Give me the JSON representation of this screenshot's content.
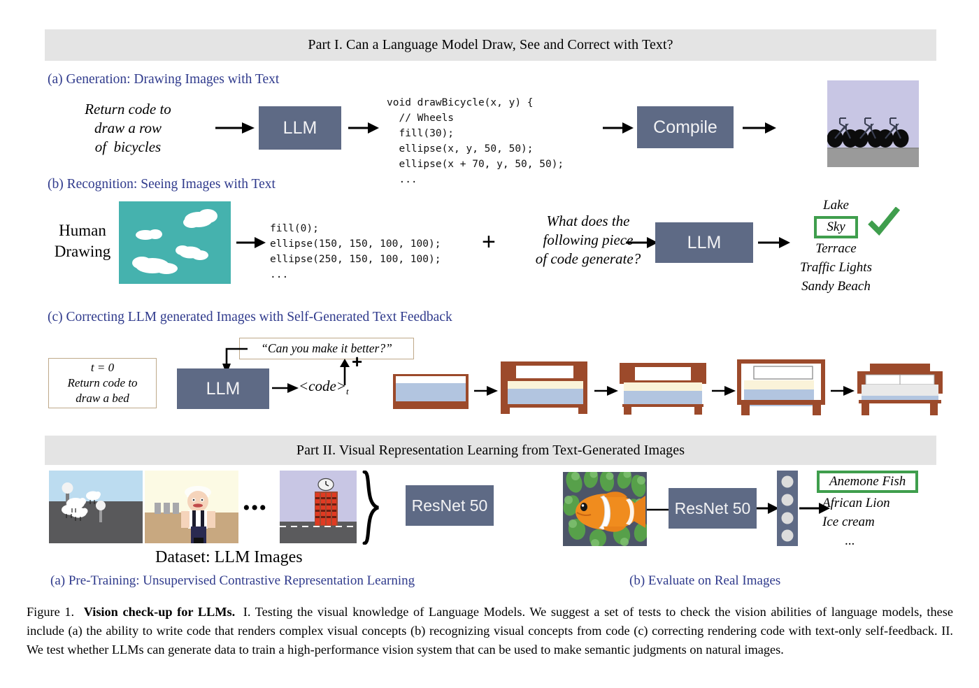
{
  "part1": {
    "banner": "Part I. Can a Language Model Draw, See and Correct with Text?",
    "section_a": {
      "heading": "(a) Generation: Drawing Images with Text",
      "prompt": "Return code to\ndraw a row\nof  bicycles",
      "llm_label": "LLM",
      "code": "void drawBicycle(x, y) {\n  // Wheels\n  fill(30);\n  ellipse(x, y, 50, 50);\n  ellipse(x + 70, y, 50, 50);\n  ...",
      "compile_label": "Compile",
      "output_image_name": "row-of-bicycles-render"
    },
    "section_b": {
      "heading": "(b) Recognition: Seeing Images with Text",
      "source_label": "Human\nDrawing",
      "drawing_name": "human-drawing-clouds",
      "code": "fill(0);\nellipse(150, 150, 100, 100);\nellipse(250, 150, 100, 100);\n...",
      "plus": "+",
      "question": "What does the\nfollowing piece\nof code generate?",
      "llm_label": "LLM",
      "answers": [
        "Lake",
        "Sky",
        "Terrace",
        "Traffic Lights",
        "Sandy Beach"
      ],
      "correct_answer": "Sky",
      "check_icon": "check-mark"
    },
    "section_c": {
      "heading": "(c) Correcting LLM generated Images with Self-Generated Text Feedback",
      "initial_prompt_line1": "t = 0",
      "initial_prompt_line2": "Return code to",
      "initial_prompt_line3": "draw a bed",
      "llm_label": "LLM",
      "code_token": "<code>",
      "code_token_sub": "t",
      "feedback": "“Can you make it better?”",
      "plus": "+",
      "bed_steps": [
        "bed-step-1",
        "bed-step-2",
        "bed-step-3",
        "bed-step-4",
        "bed-step-5"
      ]
    }
  },
  "part2": {
    "banner": "Part II. Visual Representation Learning from Text-Generated Images",
    "dataset_caption": "Dataset: LLM Images",
    "dataset_images": [
      "llm-image-sheep-field",
      "llm-image-chef-kitchen",
      "llm-image-building-clock"
    ],
    "ellipsis": "• • •",
    "model_label": "ResNet 50",
    "eval_model_label": "ResNet 50",
    "eval_image_name": "real-image-clownfish",
    "eval_answers": [
      "Anemone Fish",
      "African Lion",
      "Ice cream",
      "..."
    ],
    "eval_correct": "Anemone Fish",
    "caption_a": "(a) Pre-Training: Unsupervised Contrastive Representation Learning",
    "caption_b": "(b) Evaluate on Real Images"
  },
  "figure_caption": {
    "label": "Figure 1.",
    "bold_title": "Vision check-up for LLMs.",
    "body": "I. Testing the visual knowledge of Language Models.  We suggest a set of tests to check the vision abilities of language models, these include (a) the ability to write code that renders complex visual concepts (b) recognizing visual concepts from code (c) correcting rendering code with text-only self-feedback.  II. We test whether LLMs can generate data to train a high-performance vision system that can be used to make semantic judgments on natural images."
  },
  "colors": {
    "banner_bg": "#e4e4e4",
    "heading_blue": "#2f3a8c",
    "model_box": "#5e6a85",
    "green_accent": "#3f9e4d",
    "sky_lavender": "#c8c6e4",
    "ground_gray": "#9a9a9a",
    "teal": "#45b2ae",
    "bed_brown": "#9c4a2b",
    "bed_blue": "#b2c5e0",
    "bed_cream": "#faf3d9"
  }
}
